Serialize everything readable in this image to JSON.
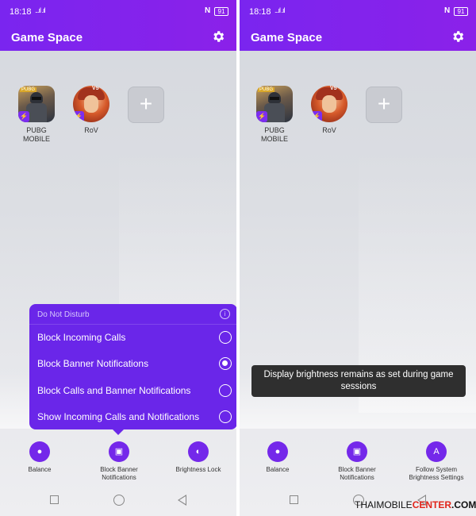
{
  "status": {
    "time": "18:18",
    "signal": "...ıl .ıl",
    "nfc": "N",
    "battery": "91"
  },
  "app": {
    "title": "Game Space",
    "settings_icon": "gear-icon",
    "accent": "#7a25ef"
  },
  "games": [
    {
      "label": "PUBG MOBILE",
      "icon": "pubg-icon",
      "tag": "PUBG"
    },
    {
      "label": "RoV",
      "icon": "rov-icon",
      "tag": "V5"
    }
  ],
  "add_tile": {
    "symbol": "+",
    "icon": "add-icon"
  },
  "dnd_menu": {
    "header": "Do Not Disturb",
    "info_icon": "i",
    "options": [
      {
        "label": "Block Incoming Calls",
        "selected": false
      },
      {
        "label": "Block Banner Notifications",
        "selected": true
      },
      {
        "label": "Block Calls and Banner Notifications",
        "selected": false
      },
      {
        "label": "Show Incoming Calls and Notifications",
        "selected": false
      }
    ]
  },
  "toast": {
    "text": "Display brightness remains as set during game sessions"
  },
  "left_buttons": [
    {
      "label": "Balance",
      "glyph": "●"
    },
    {
      "label": "Block Banner Notifications",
      "glyph": "▣"
    },
    {
      "label": "Brightness Lock",
      "glyph": "◐"
    }
  ],
  "right_buttons": [
    {
      "label": "Balance",
      "glyph": "●"
    },
    {
      "label": "Block Banner Notifications",
      "glyph": "▣"
    },
    {
      "label": "Follow System Brightness Settings",
      "glyph": "A"
    }
  ],
  "watermark": {
    "part1": "THAIMOBILE",
    "part2": "CENTER",
    "part3": ".COM",
    "copyright": "©"
  }
}
